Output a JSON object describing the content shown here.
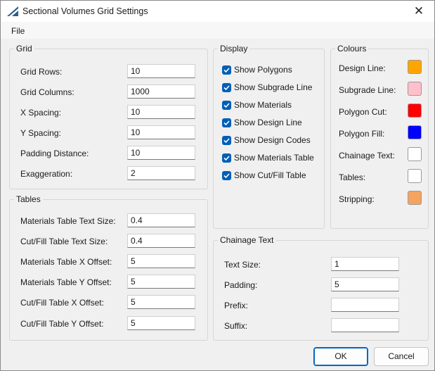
{
  "window": {
    "title": "Sectional Volumes Grid Settings"
  },
  "menu": {
    "file": "File"
  },
  "grid": {
    "title": "Grid",
    "fields": [
      {
        "label": "Grid Rows:",
        "value": "10"
      },
      {
        "label": "Grid Columns:",
        "value": "1000"
      },
      {
        "label": "X Spacing:",
        "value": "10"
      },
      {
        "label": "Y Spacing:",
        "value": "10"
      },
      {
        "label": "Padding Distance:",
        "value": "10"
      },
      {
        "label": "Exaggeration:",
        "value": "2"
      }
    ]
  },
  "tables": {
    "title": "Tables",
    "fields": [
      {
        "label": "Materials Table Text Size:",
        "value": "0.4"
      },
      {
        "label": "Cut/Fill Table Text Size:",
        "value": "0.4"
      },
      {
        "label": "Materials Table X Offset:",
        "value": "5"
      },
      {
        "label": "Materials Table Y Offset:",
        "value": "5"
      },
      {
        "label": "Cut/Fill Table X Offset:",
        "value": "5"
      },
      {
        "label": "Cut/Fill Table Y Offset:",
        "value": "5"
      }
    ]
  },
  "display": {
    "title": "Display",
    "options": [
      {
        "label": "Show Polygons",
        "checked": true
      },
      {
        "label": "Show Subgrade Line",
        "checked": true
      },
      {
        "label": "Show Materials",
        "checked": true
      },
      {
        "label": "Show Design Line",
        "checked": true
      },
      {
        "label": "Show Design Codes",
        "checked": true
      },
      {
        "label": "Show Materials Table",
        "checked": true
      },
      {
        "label": "Show Cut/Fill Table",
        "checked": true
      }
    ]
  },
  "colours": {
    "title": "Colours",
    "items": [
      {
        "label": "Design Line:",
        "color": "#ffa500"
      },
      {
        "label": "Subgrade Line:",
        "color": "#ffc0cb"
      },
      {
        "label": "Polygon Cut:",
        "color": "#ff0000"
      },
      {
        "label": "Polygon Fill:",
        "color": "#0000ff"
      },
      {
        "label": "Chainage Text:",
        "color": "#ffffff"
      },
      {
        "label": "Tables:",
        "color": "#ffffff"
      },
      {
        "label": "Stripping:",
        "color": "#f4a460"
      }
    ]
  },
  "chainage": {
    "title": "Chainage Text",
    "fields": [
      {
        "label": "Text Size:",
        "value": "1"
      },
      {
        "label": "Padding:",
        "value": "5"
      },
      {
        "label": "Prefix:",
        "value": ""
      },
      {
        "label": "Suffix:",
        "value": ""
      }
    ]
  },
  "buttons": {
    "ok": "OK",
    "cancel": "Cancel"
  }
}
